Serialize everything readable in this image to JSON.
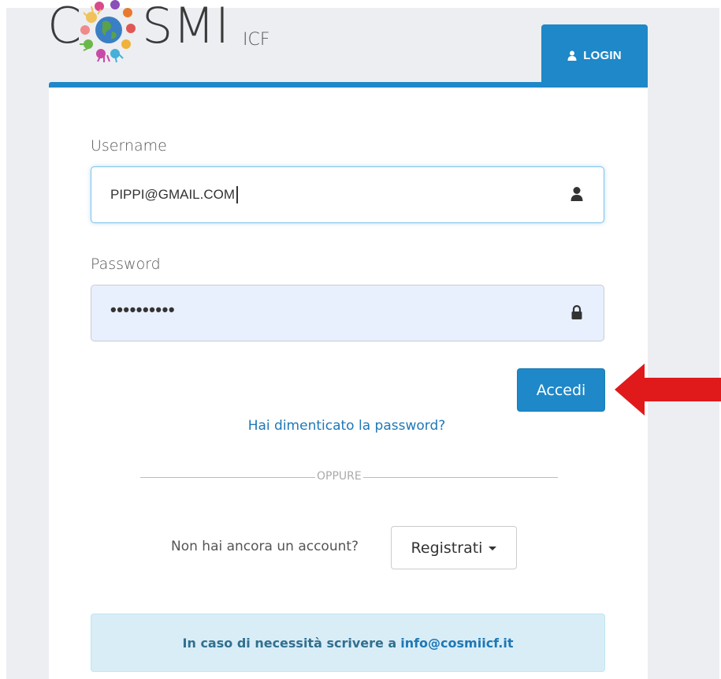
{
  "brand": {
    "logo_prefix": "C",
    "logo_main": "SMI",
    "logo_suffix": "ICF",
    "logo_alt": "COSMI ICF"
  },
  "tab": {
    "login_label": "LOGIN",
    "icon": "user-icon"
  },
  "form": {
    "username_label": "Username",
    "username_value": "PIPPI@GMAIL.COM",
    "username_icon": "user-icon",
    "password_label": "Password",
    "password_value": "••••••••••",
    "password_icon": "lock-icon",
    "submit_label": "Accedi"
  },
  "links": {
    "forgot_password": "Hai dimenticato la password?"
  },
  "divider": {
    "label": "OPPURE"
  },
  "register": {
    "prompt": "Non hai ancora un account?",
    "button_label": "Registrati"
  },
  "info": {
    "text": "In caso di necessità scrivere a",
    "email": "info@cosmiicf.it"
  },
  "colors": {
    "accent": "#1e88c8",
    "link": "#1e78b6",
    "arrow": "#e0191b",
    "info_bg": "#d9edf7"
  }
}
